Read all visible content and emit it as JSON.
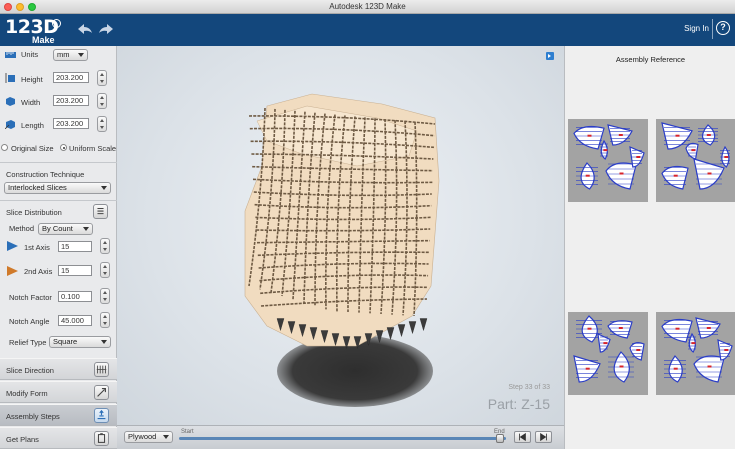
{
  "window": {
    "title": "Autodesk 123D Make"
  },
  "header": {
    "logo_main": "123D",
    "logo_sub": "Make",
    "sign_in": "Sign In",
    "help": "?"
  },
  "left": {
    "units_label": "Units",
    "units_value": "mm",
    "height_label": "Height",
    "height_value": "203.200",
    "width_label": "Width",
    "width_value": "203.200",
    "length_label": "Length",
    "length_value": "203.200",
    "original_size": "Original Size",
    "uniform_scale": "Uniform Scale",
    "construction_label": "Construction Technique",
    "construction_value": "Interlocked Slices",
    "slice_dist_label": "Slice Distribution",
    "method_label": "Method",
    "method_value": "By Count",
    "axis1_label": "1st Axis",
    "axis1_value": "15",
    "axis2_label": "2nd Axis",
    "axis2_value": "15",
    "notch_factor_label": "Notch Factor",
    "notch_factor_value": "0.100",
    "notch_angle_label": "Notch Angle",
    "notch_angle_value": "45.000",
    "relief_label": "Relief Type",
    "relief_value": "Square"
  },
  "sections": [
    {
      "label": "Slice Direction"
    },
    {
      "label": "Modify Form"
    },
    {
      "label": "Assembly Steps"
    },
    {
      "label": "Get Plans"
    }
  ],
  "viewport": {
    "step": "Step 33 of 33",
    "part": "Part: Z-15"
  },
  "bottom": {
    "material": "Plywood",
    "start": "Start",
    "end": "End"
  },
  "right": {
    "title": "Assembly Reference"
  },
  "colors": {
    "header": "#13477c",
    "wood": "#f1dcc0",
    "wood_edge": "#6e5a43",
    "sheet_bg": "#a3a3a3",
    "part_outline": "#2b3ec7",
    "part_label": "#d8232a"
  }
}
